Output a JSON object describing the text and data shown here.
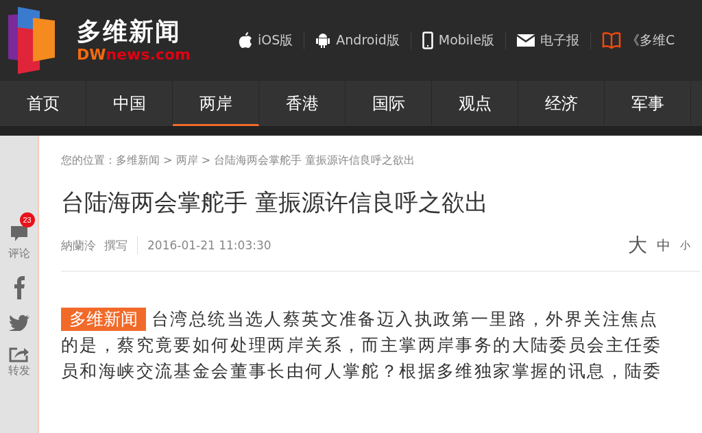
{
  "logo": {
    "name": "多维新闻",
    "domain_prefix": "DW",
    "domain": "news.com"
  },
  "top_links": [
    {
      "kind": "apple",
      "label": "iOS版"
    },
    {
      "kind": "android",
      "label": "Android版"
    },
    {
      "kind": "phone",
      "label": "Mobile版"
    },
    {
      "kind": "mail",
      "label": "电子报"
    },
    {
      "kind": "book",
      "label": "《多维C"
    }
  ],
  "nav": [
    {
      "label": "首页",
      "selected": false
    },
    {
      "label": "中国",
      "selected": false
    },
    {
      "label": "两岸",
      "selected": true
    },
    {
      "label": "香港",
      "selected": false
    },
    {
      "label": "国际",
      "selected": false
    },
    {
      "label": "观点",
      "selected": false
    },
    {
      "label": "经济",
      "selected": false
    },
    {
      "label": "军事",
      "selected": false
    }
  ],
  "share": [
    {
      "kind": "comment",
      "label": "评论",
      "badge": "23"
    },
    {
      "kind": "facebook"
    },
    {
      "kind": "twitter"
    },
    {
      "kind": "forward",
      "label": "转发"
    }
  ],
  "breadcrumb": "您的位置：多维新闻 > 两岸 > 台陆海两会掌舵手 童振源许信良呼之欲出",
  "article": {
    "title": "台陆海两会掌舵手 童振源许信良呼之欲出",
    "author": "納蘭泠",
    "role": "撰写",
    "date": "2016-01-21 11:03:30",
    "font_sizes": [
      {
        "kind": "large",
        "label": "大"
      },
      {
        "kind": "medium",
        "label": "中"
      },
      {
        "kind": "small",
        "label": "小"
      }
    ],
    "source_tag": "多维新闻",
    "body_lines": [
      "台湾总统当选人蔡英文准备迈入执政第一里路，外界关注焦点",
      "的是，蔡究竟要如何处理两岸关系，而主掌两岸事务的大陆委员会主任委",
      "员和海峡交流基金会董事长由何人掌舵？根据多维独家掌握的讯息，陆委"
    ]
  }
}
